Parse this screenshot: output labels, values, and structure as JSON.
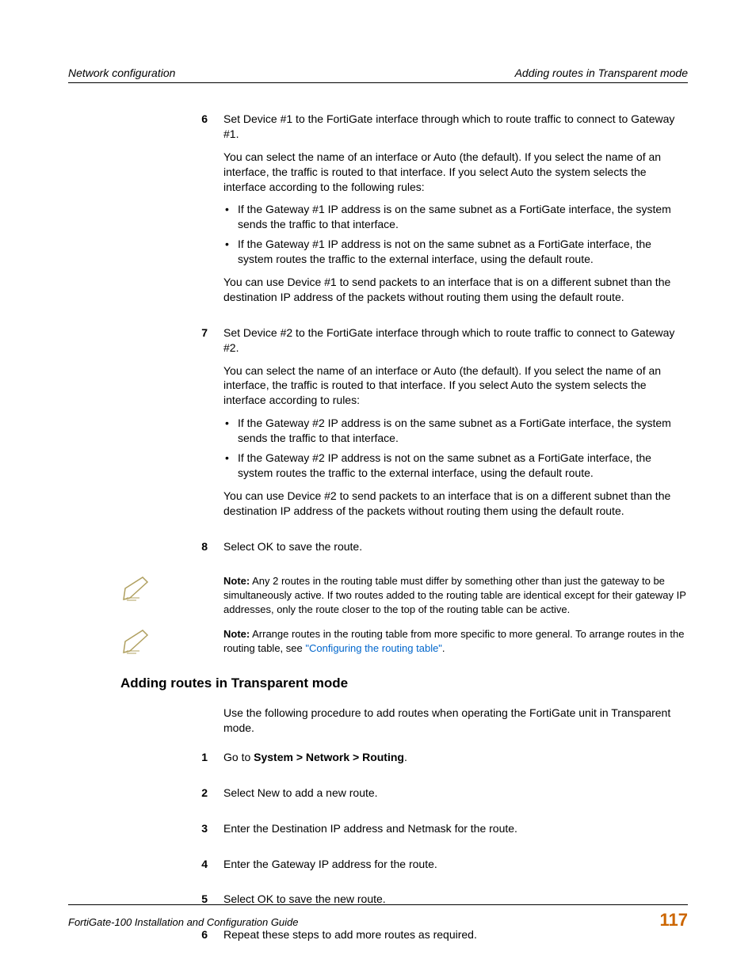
{
  "header": {
    "left": "Network configuration",
    "right": "Adding routes in Transparent mode"
  },
  "steps_a": [
    {
      "num": "6",
      "lead": "Set Device #1 to the FortiGate interface through which to route traffic to connect to Gateway #1.",
      "p1": "You can select the name of an interface or Auto (the default). If you select the name of an interface, the traffic is routed to that interface. If you select Auto the system selects the interface according to the following rules:",
      "bullets": [
        "If the Gateway #1 IP address is on the same subnet as a FortiGate interface, the system sends the traffic to that interface.",
        "If the Gateway #1 IP address is not on the same subnet as a FortiGate interface, the system routes the traffic to the external interface, using the default route."
      ],
      "p2": "You can use Device #1 to send packets to an interface that is on a different subnet than the destination IP address of the packets without routing them using the default route."
    },
    {
      "num": "7",
      "lead": "Set Device #2 to the FortiGate interface through which to route traffic to connect to Gateway #2.",
      "p1": "You can select the name of an interface or Auto (the default). If you select the name of an interface, the traffic is routed to that interface. If you select Auto the system selects the interface according to rules:",
      "bullets": [
        "If the Gateway #2 IP address is on the same subnet as a FortiGate interface, the system sends the traffic to that interface.",
        "If the Gateway #2 IP address is not on the same subnet as a FortiGate interface, the system routes the traffic to the external interface, using the default route."
      ],
      "p2": "You can use Device #2 to send packets to an interface that is on a different subnet than the destination IP address of the packets without routing them using the default route."
    },
    {
      "num": "8",
      "lead": "Select OK to save the route."
    }
  ],
  "notes": [
    {
      "label": "Note:",
      "text": " Any 2 routes in the routing table must differ by something other than just the gateway to be simultaneously active. If two routes added to the routing table are identical except for their gateway IP addresses, only the route closer to the top of the routing table can be active."
    },
    {
      "label": "Note:",
      "text_pre": " Arrange routes in the routing table from more specific to more general. To arrange routes in the routing table, see ",
      "link_text": "\"Configuring the routing table\"",
      "text_post": "."
    }
  ],
  "section": {
    "heading": "Adding routes in Transparent mode",
    "intro": "Use the following procedure to add routes when operating the FortiGate unit in Transparent mode.",
    "steps": [
      {
        "num": "1",
        "prefix": "Go to ",
        "bold": "System > Network > Routing",
        "suffix": "."
      },
      {
        "num": "2",
        "text": "Select New to add a new route."
      },
      {
        "num": "3",
        "text": "Enter the Destination IP address and Netmask for the route."
      },
      {
        "num": "4",
        "text": "Enter the Gateway IP address for the route."
      },
      {
        "num": "5",
        "text": "Select OK to save the new route."
      },
      {
        "num": "6",
        "text": "Repeat these steps to add more routes as required."
      }
    ]
  },
  "footer": {
    "left": "FortiGate-100 Installation and Configuration Guide",
    "right": "117"
  }
}
